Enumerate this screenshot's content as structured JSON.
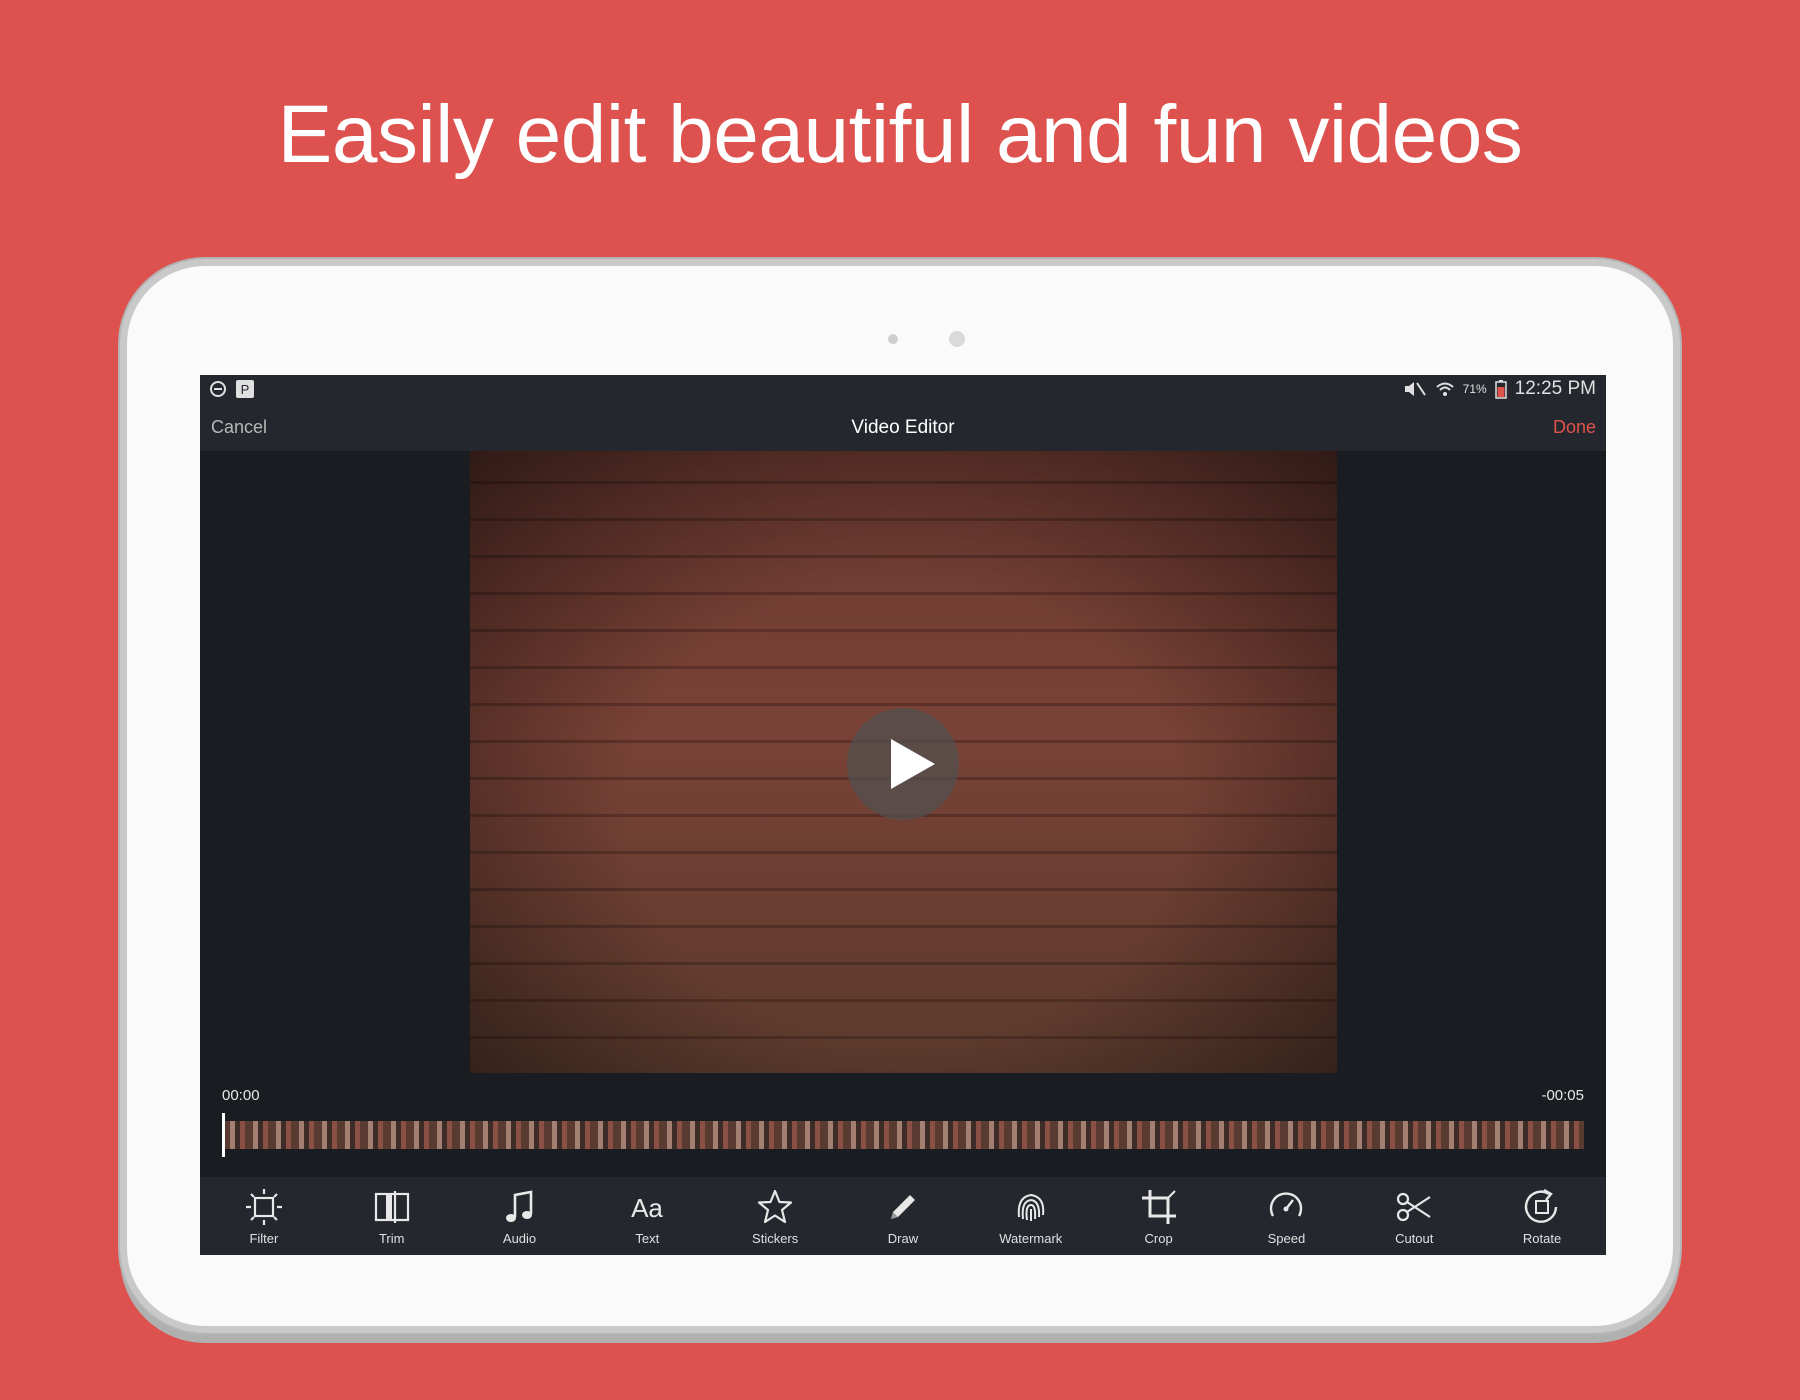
{
  "headline": "Easily edit beautiful and fun videos",
  "status_bar": {
    "battery": "71%",
    "time": "12:25 PM"
  },
  "app_bar": {
    "cancel_label": "Cancel",
    "title": "Video Editor",
    "done_label": "Done"
  },
  "player": {
    "current_time": "00:00",
    "remaining_time": "-00:05"
  },
  "toolbar": {
    "items": [
      {
        "label": "Filter",
        "icon": "filter-icon"
      },
      {
        "label": "Trim",
        "icon": "trim-icon"
      },
      {
        "label": "Audio",
        "icon": "music-note-icon"
      },
      {
        "label": "Text",
        "icon": "text-icon"
      },
      {
        "label": "Stickers",
        "icon": "star-icon"
      },
      {
        "label": "Draw",
        "icon": "pencil-icon"
      },
      {
        "label": "Watermark",
        "icon": "fingerprint-icon"
      },
      {
        "label": "Crop",
        "icon": "crop-icon"
      },
      {
        "label": "Speed",
        "icon": "speedometer-icon"
      },
      {
        "label": "Cutout",
        "icon": "scissors-icon"
      },
      {
        "label": "Rotate",
        "icon": "rotate-icon"
      }
    ]
  },
  "colors": {
    "background": "#dd524e",
    "accent": "#e0544b",
    "app_bar": "#24272d",
    "screen": "#191c20"
  }
}
